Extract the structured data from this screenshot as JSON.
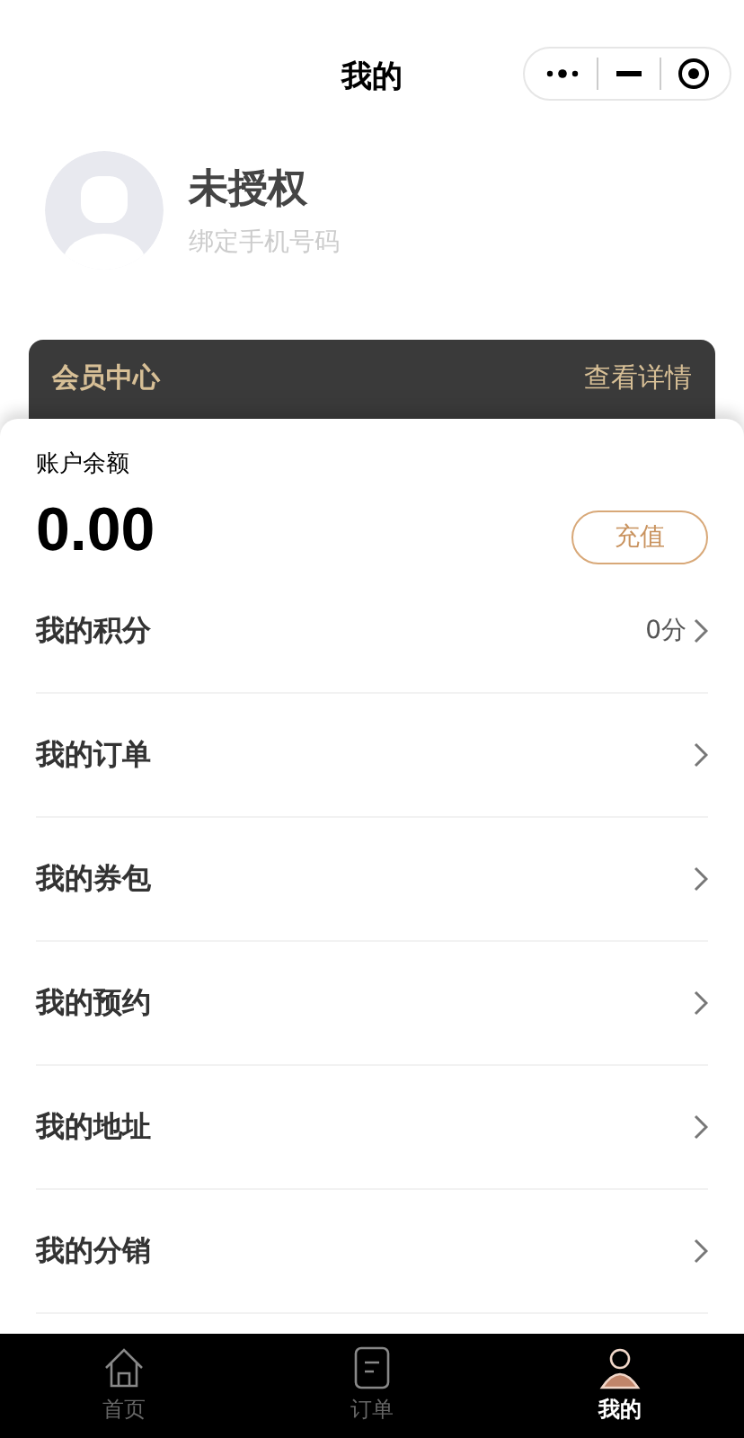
{
  "nav_bar": {
    "title": "我的"
  },
  "profile": {
    "name": "未授权",
    "subtitle": "绑定手机号码"
  },
  "member_card": {
    "title": "会员中心",
    "link": "查看详情"
  },
  "balance": {
    "label": "账户余额",
    "amount": "0.00",
    "button": "充值"
  },
  "menu": [
    {
      "label": "我的积分",
      "value": "0分"
    },
    {
      "label": "我的订单"
    },
    {
      "label": "我的券包"
    },
    {
      "label": "我的预约"
    },
    {
      "label": "我的地址"
    },
    {
      "label": "我的分销"
    }
  ],
  "tab_bar": [
    {
      "kind": "home",
      "label": "首页",
      "selected": false
    },
    {
      "kind": "order",
      "label": "订单",
      "selected": false
    },
    {
      "kind": "profile",
      "label": "我的",
      "selected": true
    }
  ]
}
